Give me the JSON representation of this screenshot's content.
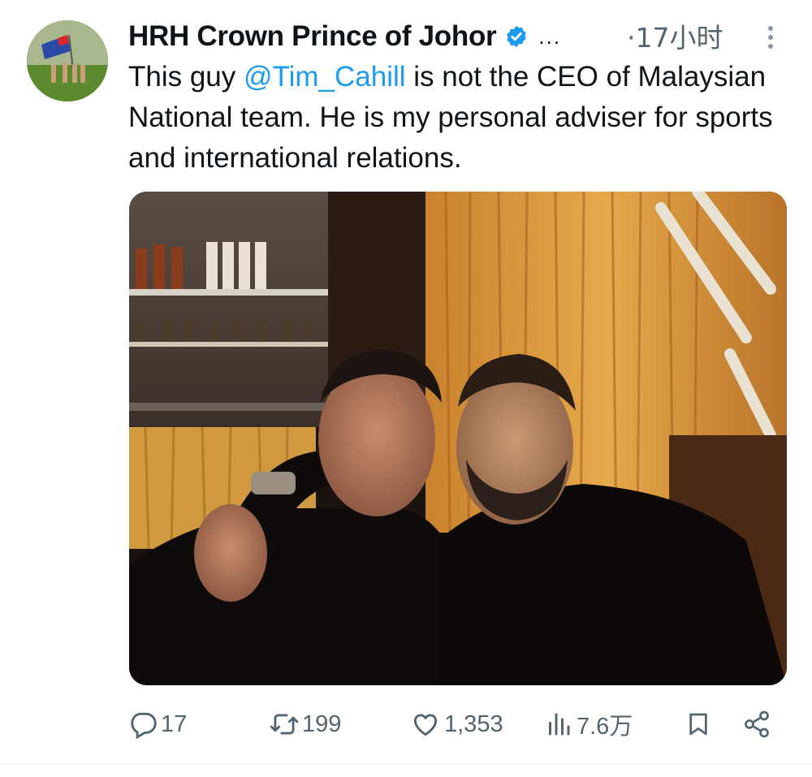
{
  "author": {
    "name": "HRH Crown Prince of Johor",
    "verified": true,
    "ellipsis": "...",
    "time": "·17小时",
    "avatar_icon": "avatar-photo"
  },
  "tweet": {
    "text_before": "This guy ",
    "mention": "@Tim_Cahill",
    "text_after": " is not the CEO of Malaysian National team. He is my personal adviser for sports and international relations."
  },
  "media": {
    "icon": "photo"
  },
  "actions": {
    "reply_count": "17",
    "retweet_count": "199",
    "like_count": "1,353",
    "view_count": "7.6万"
  },
  "colors": {
    "accent": "#1d9bf0",
    "secondary_text": "#536471",
    "text": "#0f1419"
  }
}
